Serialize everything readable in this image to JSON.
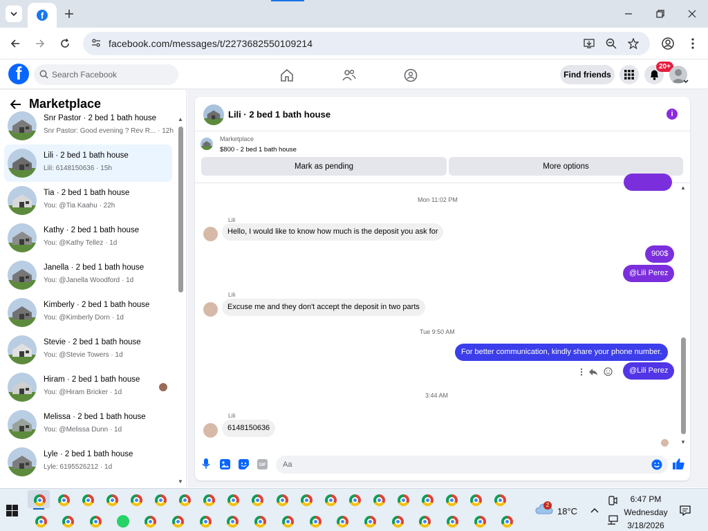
{
  "browser": {
    "url": "facebook.com/messages/t/2273682550109214"
  },
  "fb_header": {
    "search_placeholder": "Search Facebook",
    "find_friends": "Find friends",
    "notification_badge": "20+"
  },
  "left_panel": {
    "title": "Marketplace",
    "conversations": [
      {
        "title": "Snr Pastor · 2 bed 1 bath house",
        "preview": "Snr Pastor: Good evening ? Rev R... · 12h",
        "active": false
      },
      {
        "title": "Lili · 2 bed 1 bath house",
        "preview": "Lili: 6148150636 · 15h",
        "active": true
      },
      {
        "title": "Tia · 2 bed 1 bath house",
        "preview": "You: @Tia Kaahu · 22h",
        "active": false
      },
      {
        "title": "Kathy · 2 bed 1 bath house",
        "preview": "You: @Kathy Tellez · 1d",
        "active": false
      },
      {
        "title": "Janella · 2 bed 1 bath house",
        "preview": "You: @Janella Woodford · 1d",
        "active": false
      },
      {
        "title": "Kimberly · 2 bed 1 bath house",
        "preview": "You: @Kimberly Dorn · 1d",
        "active": false
      },
      {
        "title": "Stevie · 2 bed 1 bath house",
        "preview": "You: @Stevie Towers · 1d",
        "active": false
      },
      {
        "title": "Hiram · 2 bed 1 bath house",
        "preview": "You: @Hiram Bricker · 1d",
        "active": false
      },
      {
        "title": "Melissa · 2 bed 1 bath house",
        "preview": "You: @Melissa Dunn · 1d",
        "active": false
      },
      {
        "title": "Lyle · 2 bed 1 bath house",
        "preview": "Lyle: 6195526212 · 1d",
        "active": false
      }
    ]
  },
  "chat": {
    "title": "Lili · 2 bed 1 bath house",
    "marketplace_label": "Marketplace",
    "listing": "$800 - 2 bed 1 bath house",
    "mark_pending": "Mark as pending",
    "more_options": "More options",
    "timestamps": [
      "Mon 11:02 PM",
      "Tue 9:50 AM",
      "3:44 AM"
    ],
    "sender_name": "Lili",
    "messages": {
      "m1": "Hello, I would like to know how much is the deposit you ask for",
      "m2": "900$",
      "m3": "@Lili Perez",
      "m4": "Excuse me and they don't accept the deposit in two parts",
      "m5": "For better communication, kindly share your phone number.",
      "m6": "@Lili Perez",
      "m7": "6148150636"
    },
    "composer_placeholder": "Aa"
  },
  "taskbar": {
    "weather_badge": "2",
    "temperature": "18°C",
    "time": "6:47 PM",
    "day": "Wednesday",
    "date": "3/18/2026"
  },
  "colors": {
    "fb_blue": "#0866ff",
    "outgoing_purple": "#7b2fdc",
    "outgoing_blue": "#3b3eea",
    "active_row": "#ebf5ff",
    "badge_red": "#e41e3f"
  }
}
